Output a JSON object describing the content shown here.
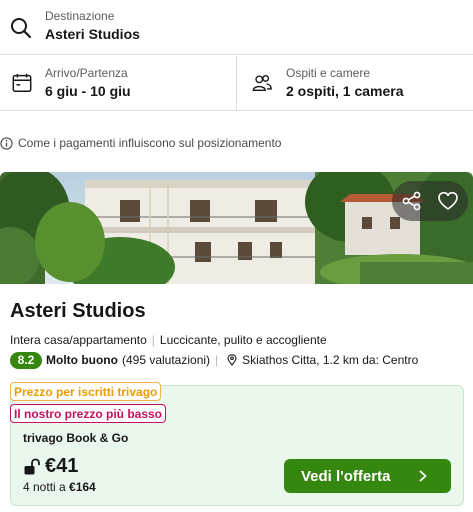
{
  "search": {
    "destination_label": "Destinazione",
    "destination_value": "Asteri Studios",
    "dates_label": "Arrivo/Partenza",
    "dates_value": "6 giu - 10 giu",
    "guests_label": "Ospiti e camere",
    "guests_value": "2 ospiti, 1 camera"
  },
  "info": {
    "text": "Come i pagamenti influiscono sul posizionamento"
  },
  "hotel": {
    "name": "Asteri Studios",
    "type": "Intera casa/appartamento",
    "highlights": "Luccicante, pulito e accogliente",
    "rating_score": "8.2",
    "rating_word": "Molto buono",
    "rating_count": "(495 valutazioni)",
    "location": "Skiathos Citta, 1.2 km da: Centro"
  },
  "deal": {
    "tag_member": "Prezzo per iscritti trivago",
    "tag_best": "Il nostro prezzo più basso",
    "provider": "trivago Book & Go",
    "price": "€41",
    "nights_prefix": "4 notti a ",
    "total": "€164",
    "cta_label": "Vedi l'offerta"
  },
  "icons": {
    "search": "search-icon",
    "calendar": "calendar-icon",
    "guests": "guests-icon",
    "info": "info-icon",
    "share": "share-icon",
    "favorite": "heart-icon",
    "location": "location-pin-icon",
    "lock": "unlock-icon",
    "chevron": "chevron-right-icon"
  },
  "colors": {
    "accent_green": "#36870f",
    "deal_bg": "#eaf7ec",
    "member_tag": "#ef9b00",
    "best_price_tag": "#c4125b"
  }
}
